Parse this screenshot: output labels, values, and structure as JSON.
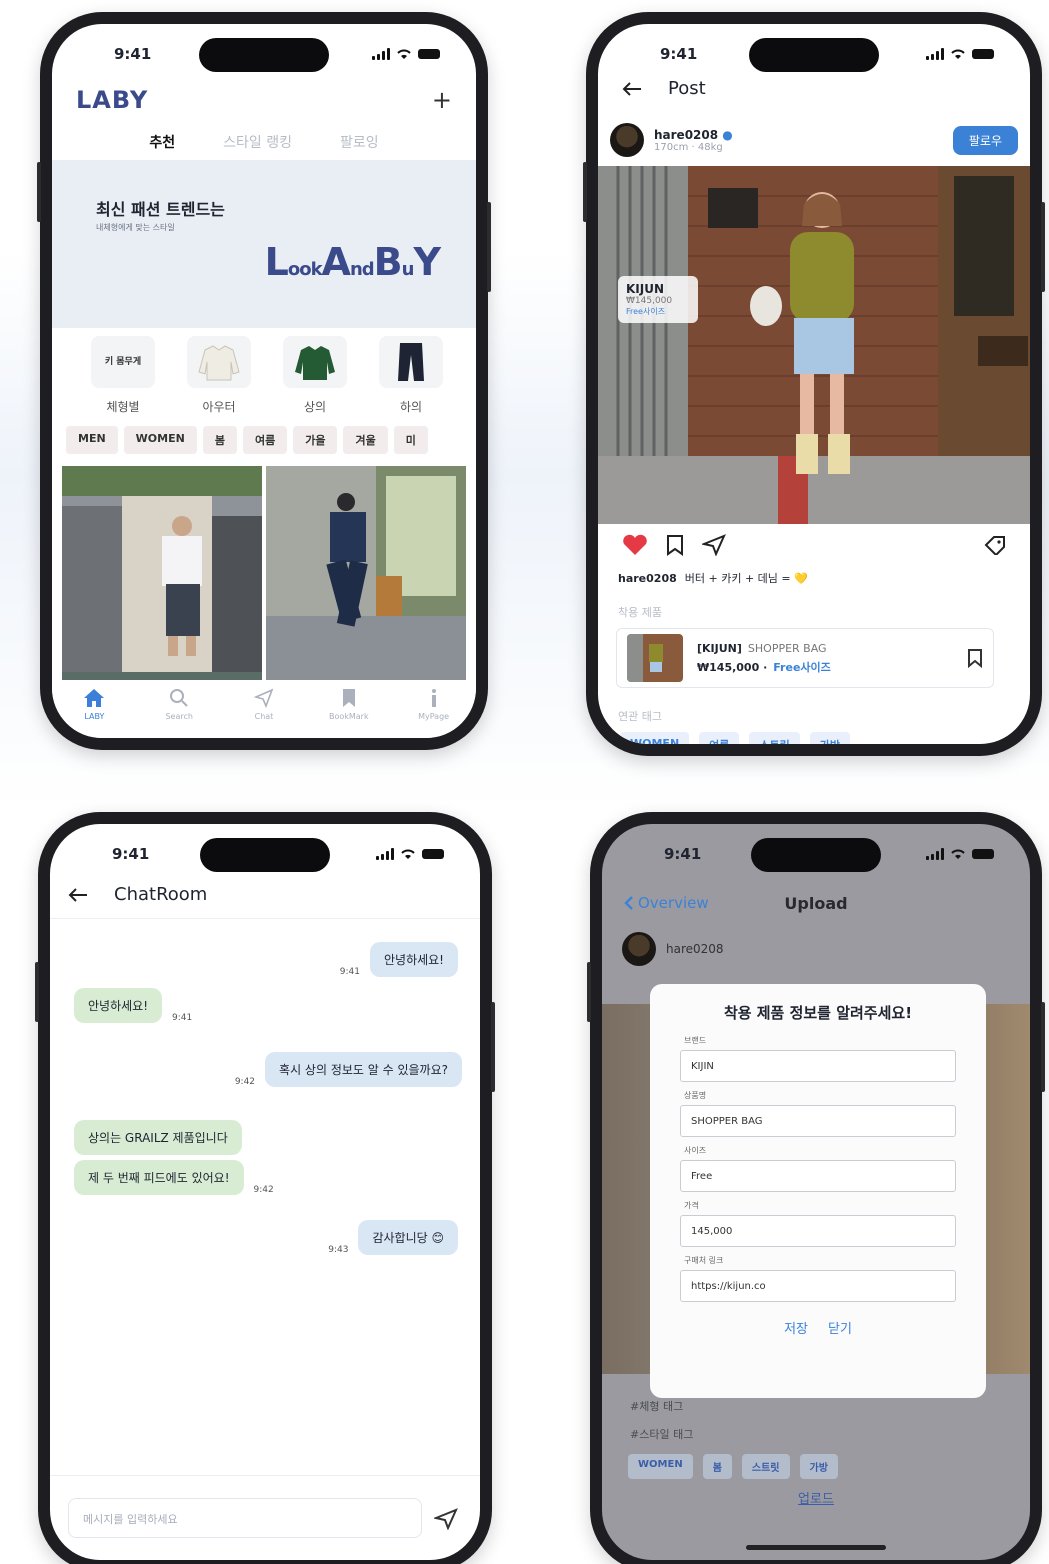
{
  "status": {
    "time": "9:41"
  },
  "home": {
    "logo": "LABY",
    "plus": "+",
    "tabs": [
      "추천",
      "스타일 랭킹",
      "팔로잉"
    ],
    "banner_title": "최신 패션 트렌드는",
    "banner_sub": "내체형에게 맞는 스타일",
    "banner_logo_parts": [
      "L",
      "ook",
      "A",
      "nd",
      "B",
      "u",
      "Y"
    ],
    "categories": [
      {
        "label": "체형별",
        "icon": "body-type-icon",
        "box_text": "키 몸무게"
      },
      {
        "label": "아우터",
        "icon": "jacket-icon"
      },
      {
        "label": "상의",
        "icon": "sweater-icon"
      },
      {
        "label": "하의",
        "icon": "pants-icon"
      }
    ],
    "chips": [
      "MEN",
      "WOMEN",
      "봄",
      "여름",
      "가을",
      "겨울",
      "미"
    ],
    "tabbar": [
      {
        "label": "LABY",
        "icon": "home-icon"
      },
      {
        "label": "Search",
        "icon": "search-icon"
      },
      {
        "label": "Chat",
        "icon": "send-icon"
      },
      {
        "label": "BookMark",
        "icon": "bookmark-icon"
      },
      {
        "label": "MyPage",
        "icon": "info-icon"
      }
    ]
  },
  "post": {
    "title": "Post",
    "username": "hare0208",
    "meta": "170cm · 48kg",
    "follow": "팔로우",
    "tag_brand": "KIJUN",
    "tag_price": "₩145,000",
    "tag_size": "Free사이즈",
    "caption_user": "hare0208",
    "caption_text": "버터 + 카키 + 데님 = 💛",
    "worn_label": "착용 제품",
    "product_brand": "[KIJUN]",
    "product_name": "SHOPPER BAG",
    "product_price": "₩145,000 ·",
    "product_size": "Free사이즈",
    "related_label": "연관 태그",
    "tags": [
      "WOMEN",
      "여름",
      "스트릿",
      "가방"
    ]
  },
  "chat": {
    "title": "ChatRoom",
    "messages": [
      {
        "side": "me",
        "text": "안녕하세요!",
        "time": "9:41"
      },
      {
        "side": "other",
        "text": "안녕하세요!",
        "time": "9:41"
      },
      {
        "side": "me",
        "text": "혹시 상의 정보도 알 수 있을까요?",
        "time": "9:42"
      },
      {
        "side": "other",
        "text": "상의는 GRAILZ 제품입니다",
        "time": ""
      },
      {
        "side": "other",
        "text": "제 두 번째 피드에도 있어요!",
        "time": "9:42"
      },
      {
        "side": "me",
        "text": "감사합니당 😊",
        "time": "9:43"
      }
    ],
    "placeholder": "메시지를 입력하세요"
  },
  "upload": {
    "back": "Overview",
    "title": "Upload",
    "username": "hare0208",
    "modal_title": "착용 제품 정보를 알려주세요!",
    "fields": [
      {
        "label": "브랜드",
        "value": "KIJIN"
      },
      {
        "label": "상품명",
        "value": "SHOPPER BAG"
      },
      {
        "label": "사이즈",
        "value": "Free"
      },
      {
        "label": "가격",
        "value": "145,000"
      },
      {
        "label": "구매처 링크",
        "value": "https://kijun.co"
      }
    ],
    "save": "저장",
    "close": "닫기",
    "body_tag_label": "#체형 태그",
    "style_tag_label": "#스타일 태그",
    "tags": [
      "WOMEN",
      "봄",
      "스트릿",
      "가방"
    ],
    "submit": "업로드"
  },
  "colors": {
    "brand": "#3a4a8a",
    "accent": "#3b82d6",
    "like": "#e53945"
  }
}
